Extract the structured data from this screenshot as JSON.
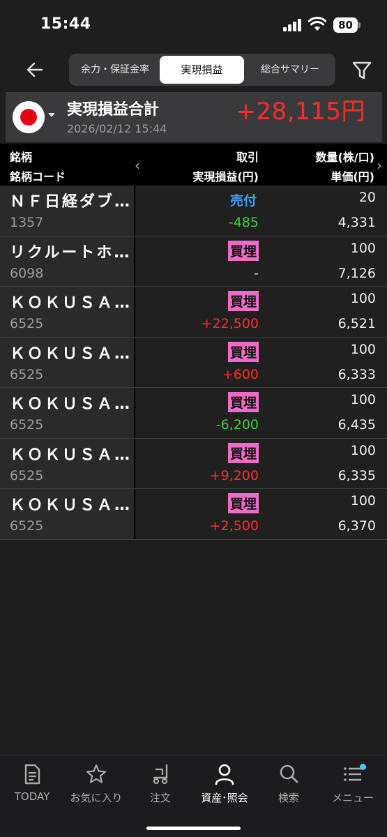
{
  "status": {
    "time": "15:44",
    "battery": "80"
  },
  "tabs": [
    {
      "label": "余力・保証金率"
    },
    {
      "label": "実現損益"
    },
    {
      "label": "総合サマリー"
    }
  ],
  "summary": {
    "label": "実現損益合計",
    "date": "2026/02/12 15:44",
    "total": "+28,115円"
  },
  "columns": {
    "name": "銘柄",
    "code": "銘柄コード",
    "trade": "取引",
    "pl": "実現損益(円)",
    "qty": "数量(株/口)",
    "price": "単価(円)",
    "prev": "‹",
    "next": "›"
  },
  "rows": [
    {
      "name": "ＮＦ日経ダブ…",
      "code": "1357",
      "trade": "売付",
      "pl": "-485",
      "qty": "20",
      "price": "4,331"
    },
    {
      "name": "リクルートホ…",
      "code": "6098",
      "trade": "買埋",
      "pl": "-",
      "qty": "100",
      "price": "7,126"
    },
    {
      "name": "ＫＯＫＵＳＡ…",
      "code": "6525",
      "trade": "買埋",
      "pl": "+22,500",
      "qty": "100",
      "price": "6,521"
    },
    {
      "name": "ＫＯＫＵＳＡ…",
      "code": "6525",
      "trade": "買埋",
      "pl": "+600",
      "qty": "100",
      "price": "6,333"
    },
    {
      "name": "ＫＯＫＵＳＡ…",
      "code": "6525",
      "trade": "買埋",
      "pl": "-6,200",
      "qty": "100",
      "price": "6,435"
    },
    {
      "name": "ＫＯＫＵＳＡ…",
      "code": "6525",
      "trade": "買埋",
      "pl": "+9,200",
      "qty": "100",
      "price": "6,335"
    },
    {
      "name": "ＫＯＫＵＳＡ…",
      "code": "6525",
      "trade": "買埋",
      "pl": "+2,500",
      "qty": "100",
      "price": "6,370"
    }
  ],
  "nav": [
    {
      "label": "TODAY",
      "icon": "document-icon"
    },
    {
      "label": "お気に入り",
      "icon": "star-icon"
    },
    {
      "label": "注文",
      "icon": "cart-icon"
    },
    {
      "label": "資産･照会",
      "icon": "person-icon"
    },
    {
      "label": "検索",
      "icon": "search-icon"
    },
    {
      "label": "メニュー",
      "icon": "menu-icon"
    }
  ],
  "colors": {
    "profit": "#ff2a2a",
    "loss": "#3ccf3c",
    "sell": "#3fa0ff",
    "buy_badge": "#f06ac8",
    "notification_dot": "#4fc3f7"
  }
}
